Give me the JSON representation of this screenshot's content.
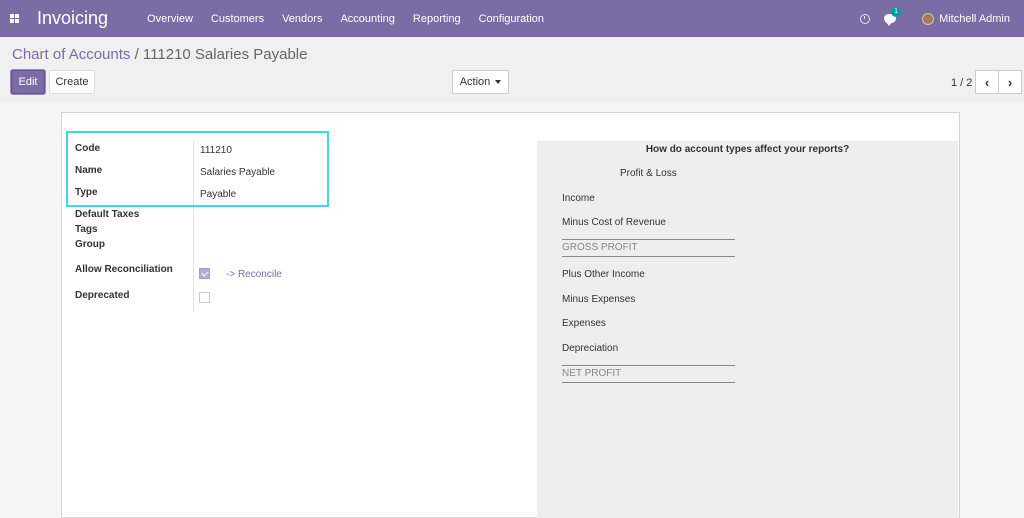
{
  "navbar": {
    "app_name": "Invoicing",
    "menu": [
      "Overview",
      "Customers",
      "Vendors",
      "Accounting",
      "Reporting",
      "Configuration"
    ],
    "chat_badge": "1",
    "user_name": "Mitchell Admin",
    "background_color": "#7c6ca6"
  },
  "breadcrumb": {
    "parent": "Chart of Accounts",
    "separator": "/",
    "current": "111210 Salaries Payable"
  },
  "buttons": {
    "edit": "Edit",
    "create": "Create",
    "action": "Action"
  },
  "pager": {
    "value": "1 / 2",
    "prev_icon": "chevron-left",
    "next_icon": "chevron-right"
  },
  "form": {
    "code_label": "Code",
    "code_value": "111210",
    "name_label": "Name",
    "name_value": "Salaries Payable",
    "type_label": "Type",
    "type_value": "Payable",
    "default_taxes_label": "Default Taxes",
    "tags_label": "Tags",
    "group_label": "Group",
    "allow_reconciliation_label": "Allow Reconciliation",
    "allow_reconciliation_checked": true,
    "reconcile_link": "-> Reconcile",
    "deprecated_label": "Deprecated",
    "deprecated_checked": false,
    "highlight_color": "#3ed8e8"
  },
  "help": {
    "title": "How do account types affect your reports?",
    "subtitle": "Profit & Loss",
    "income": "Income",
    "minus_cost": "Minus Cost of Revenue",
    "gross_profit": "GROSS PROFIT",
    "plus_other": "Plus Other Income",
    "minus_expenses": "Minus Expenses",
    "expenses": "Expenses",
    "depreciation": "Depreciation",
    "net_profit": "NET PROFIT"
  }
}
